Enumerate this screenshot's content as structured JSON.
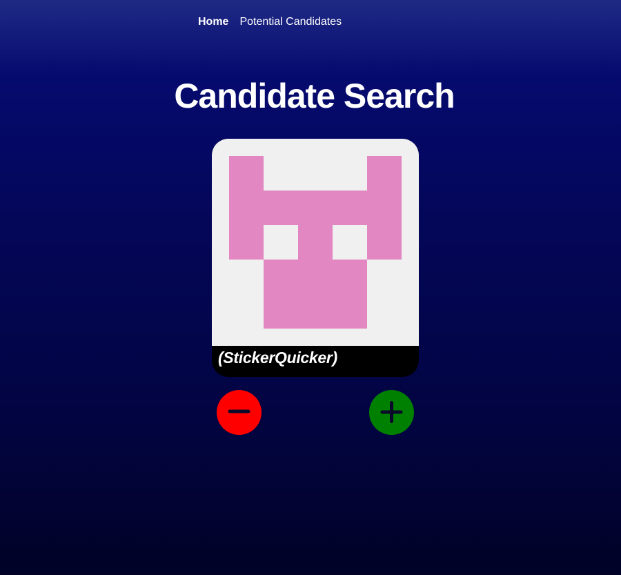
{
  "nav": {
    "items": [
      {
        "label": "Home",
        "active": true
      },
      {
        "label": "Potential Candidates",
        "active": false
      }
    ]
  },
  "page": {
    "title": "Candidate Search"
  },
  "candidate": {
    "username": "(StickerQuicker)",
    "avatar": {
      "icon": "identicon-avatar",
      "background_color": "#f0f0f0",
      "pattern_color": "#e287c1"
    }
  },
  "actions": {
    "reject": {
      "icon": "minus-icon",
      "color": "#ff0000"
    },
    "accept": {
      "icon": "plus-icon",
      "color": "#008000"
    }
  }
}
